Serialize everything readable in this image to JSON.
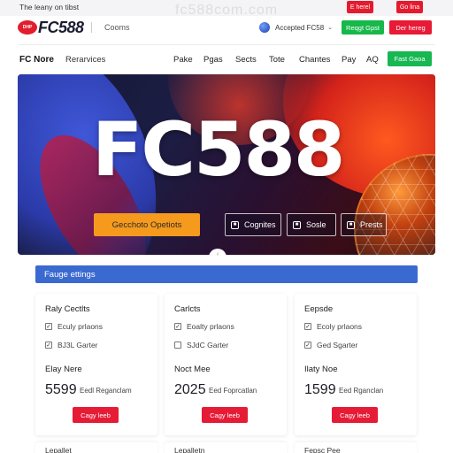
{
  "topbar": {
    "tagline": "The leany on tibst",
    "watermark": "fc588com.com",
    "btn1": "E herel",
    "btn2": "Go lina"
  },
  "header": {
    "logo_badge": "DHP",
    "logo_text": "FC588",
    "link": "Cooms",
    "language": "Accepted FC58",
    "green_btn": "Reqgt Gpst",
    "red_btn": "Der hereg"
  },
  "nav": {
    "home": "FC Nore",
    "resources": "Rerarvices",
    "items": [
      "Pake",
      "Pgas",
      "Sects",
      "Tote",
      "Chantes",
      "Pay",
      "AQ"
    ],
    "cta": "Fast Gaoa"
  },
  "hero": {
    "title": "FC588",
    "cta": "Gecchoto Opetiots",
    "chips": [
      "Cognites",
      "Sosle",
      "Prests"
    ]
  },
  "section": {
    "title": "Fauge ettings"
  },
  "cards": [
    {
      "title": "Raly Cectlts",
      "options": [
        "Eculy prlaons",
        "BJ3L Garter"
      ],
      "label": "Elay Nere",
      "number": "5599",
      "unit": "Eedl Reganclam",
      "button": "Cagy leeb"
    },
    {
      "title": "Carlcts",
      "options": [
        "Eoalty prlaons",
        "SJdC Garter"
      ],
      "label": "Noct Mee",
      "number": "2025",
      "unit": "Eed Foprcatlan",
      "button": "Cagy leeb"
    },
    {
      "title": "Eepsde",
      "options": [
        "Ecoly prlaons",
        "Ged Sgarter"
      ],
      "label": "Ilaty Noe",
      "number": "1599",
      "unit": "Eed Rganclan",
      "button": "Cagy leeb"
    }
  ],
  "peek": [
    "Lepallet",
    "Lepalletn",
    "Fepsc Pee"
  ],
  "colors": {
    "accent_red": "#e61b35",
    "accent_green": "#16b84a",
    "section_blue": "#3a6ad0",
    "hero_cta_orange": "#f59a1d"
  },
  "icons": [
    "globe-icon",
    "chevron-down-icon",
    "checkbox-icon",
    "carousel-arrow-icon"
  ]
}
